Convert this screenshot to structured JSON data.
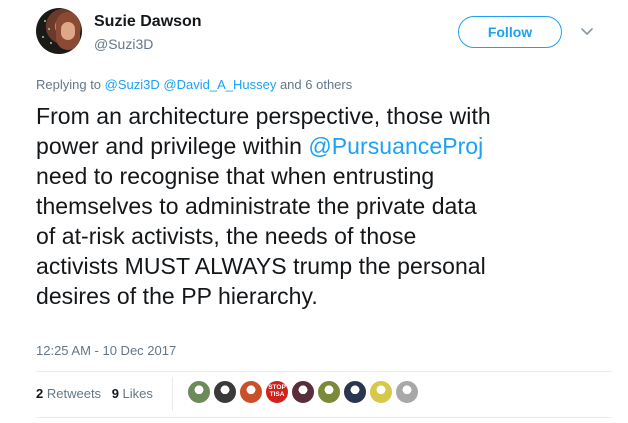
{
  "author": {
    "name": "Suzie Dawson",
    "handle": "@Suzi3D"
  },
  "follow_label": "Follow",
  "reply_context": {
    "prefix": "Replying to",
    "mentions": [
      "@Suzi3D",
      "@David_A_Hussey"
    ],
    "suffix": "and 6 others"
  },
  "tweet": {
    "lines": [
      {
        "before": "From an architecture perspective, those with",
        "mention": "",
        "after": ""
      },
      {
        "before": "power and privilege within ",
        "mention": "@PursuanceProj",
        "after": ""
      },
      {
        "before": "need to recognise that when entrusting",
        "mention": "",
        "after": ""
      },
      {
        "before": "themselves to administrate the private data",
        "mention": "",
        "after": ""
      },
      {
        "before": "of at-risk activists, the needs of those",
        "mention": "",
        "after": ""
      },
      {
        "before": "activists MUST ALWAYS trump the personal",
        "mention": "",
        "after": ""
      },
      {
        "before": "desires of the PP hierarchy.",
        "mention": "",
        "after": ""
      }
    ]
  },
  "timestamp": "12:25 AM - 10 Dec 2017",
  "stats": {
    "retweets_count": "2",
    "retweets_label": "Retweets",
    "likes_count": "9",
    "likes_label": "Likes"
  },
  "likers": [
    {
      "icon": "liker-avatar-1",
      "color": "#6d8a5a"
    },
    {
      "icon": "liker-avatar-2",
      "color": "#3a3a3a"
    },
    {
      "icon": "liker-avatar-3",
      "color": "#c9502a"
    },
    {
      "icon": "liker-avatar-stop-tisa",
      "color": "#d0211c",
      "text": "STOP TISA"
    },
    {
      "icon": "liker-avatar-5",
      "color": "#5a2d3a"
    },
    {
      "icon": "liker-avatar-6",
      "color": "#7a8a3a"
    },
    {
      "icon": "liker-avatar-7",
      "color": "#2a3550"
    },
    {
      "icon": "liker-avatar-8",
      "color": "#d8c84a"
    },
    {
      "icon": "liker-avatar-9",
      "color": "#a8a8a8"
    }
  ],
  "colors": {
    "link": "#1da1f2",
    "text": "#14171a",
    "secondary": "#657786",
    "divider": "#e6ecf0"
  }
}
